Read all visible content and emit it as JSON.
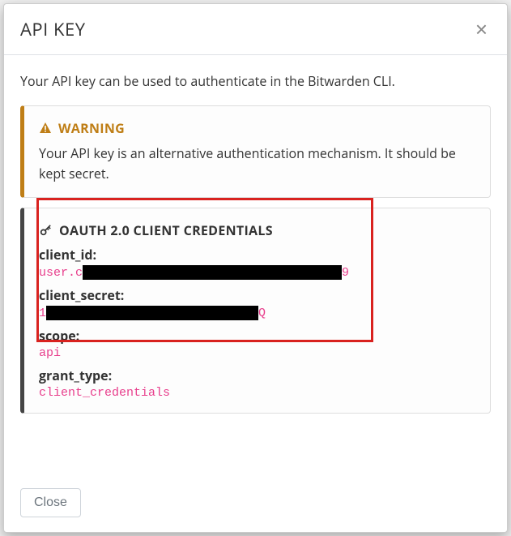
{
  "modal": {
    "title": "API KEY",
    "description": "Your API key can be used to authenticate in the Bitwarden CLI.",
    "close_label": "Close"
  },
  "warning": {
    "heading": "WARNING",
    "body": "Your API key is an alternative authentication mechanism. It should be kept secret."
  },
  "credentials": {
    "heading": "OAUTH 2.0 CLIENT CREDENTIALS",
    "client_id_label": "client_id:",
    "client_id_prefix": "user.c",
    "client_id_suffix": "9",
    "client_secret_label": "client_secret:",
    "client_secret_prefix": "1",
    "client_secret_suffix": "Q",
    "scope_label": "scope:",
    "scope_value": "api",
    "grant_type_label": "grant_type:",
    "grant_type_value": "client_credentials"
  }
}
